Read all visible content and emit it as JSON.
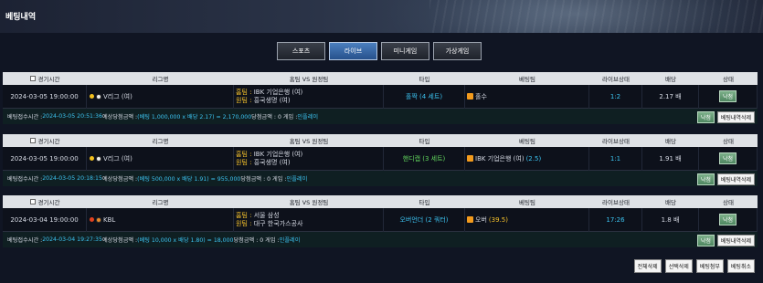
{
  "page": {
    "title": "베팅내역"
  },
  "tabs": [
    {
      "label": "스포츠",
      "active": false
    },
    {
      "label": "라이브",
      "active": true
    },
    {
      "label": "미니게임",
      "active": false
    },
    {
      "label": "가상게임",
      "active": false
    }
  ],
  "columns": [
    "경기시간",
    "리그명",
    "홈팀 VS 원정팀",
    "타입",
    "베팅팀",
    "라이브상태",
    "배당",
    "상태"
  ],
  "bets": [
    {
      "time": "2024-03-05 19:00:00",
      "league": "V리그 (여)",
      "home_label": "홈팀 :",
      "home": "IBK 기업은행 (여)",
      "away_label": "원팀 :",
      "away": "흥국생명 (여)",
      "type": "홀짝 (4 세트)",
      "pick": "홀수",
      "live": "1:2",
      "odds": "2.17 배",
      "status": "낙첨",
      "info_prefix": "베팅접수시간 : ",
      "info_time": "2024-03-05 20:51:36",
      "info_expect_label": " 예상당첨금액 : ",
      "info_expect": "(베팅 1,000,000 x 배당 2.17) = 2,170,000",
      "info_win": " 당첨금액 : 0 게임 : ",
      "info_game": "인플레이",
      "btn_status": "낙첨",
      "btn_delete": "베팅내역삭제"
    },
    {
      "time": "2024-03-05 19:00:00",
      "league": "V리그 (여)",
      "home_label": "홈팀 :",
      "home": "IBK 기업은행 (여)",
      "away_label": "원팀 :",
      "away": "흥국생명 (여)",
      "type": "핸디캡 (3 세트)",
      "pick": "IBK 기업은행 (여)",
      "pick_extra": "(2.5)",
      "live": "1:1",
      "odds": "1.91 배",
      "status": "낙첨",
      "info_prefix": "베팅접수시간 : ",
      "info_time": "2024-03-05 20:18:15",
      "info_expect_label": " 예상당첨금액 : ",
      "info_expect": "(베팅 500,000 x 배당 1.91) = 955,000",
      "info_win": " 당첨금액 : 0 게임 : ",
      "info_game": "인플레이",
      "btn_status": "낙첨",
      "btn_delete": "베팅내역삭제"
    },
    {
      "time": "2024-03-04 19:00:00",
      "league": "KBL",
      "home_label": "홈팀 :",
      "home": "서울 삼성",
      "away_label": "원팀 :",
      "away": "대구 한국가스공사",
      "type": "오버언더 (2 쿼터)",
      "pick": "오버",
      "pick_extra": "(39.5)",
      "live": "17:26",
      "odds": "1.8 배",
      "status": "낙첨",
      "info_prefix": "베팅접수시간 : ",
      "info_time": "2024-03-04 19:27:35",
      "info_expect_label": " 예상당첨금액 : ",
      "info_expect": "(베팅 10,000 x 배당 1.80) = 18,000",
      "info_win": " 당첨금액 : 0 게임 : ",
      "info_game": "인플레이",
      "btn_status": "낙첨",
      "btn_delete": "베팅내역삭제"
    }
  ],
  "bottom_buttons": [
    "전체삭제",
    "선택삭제",
    "베팅첨부",
    "베팅취소"
  ]
}
